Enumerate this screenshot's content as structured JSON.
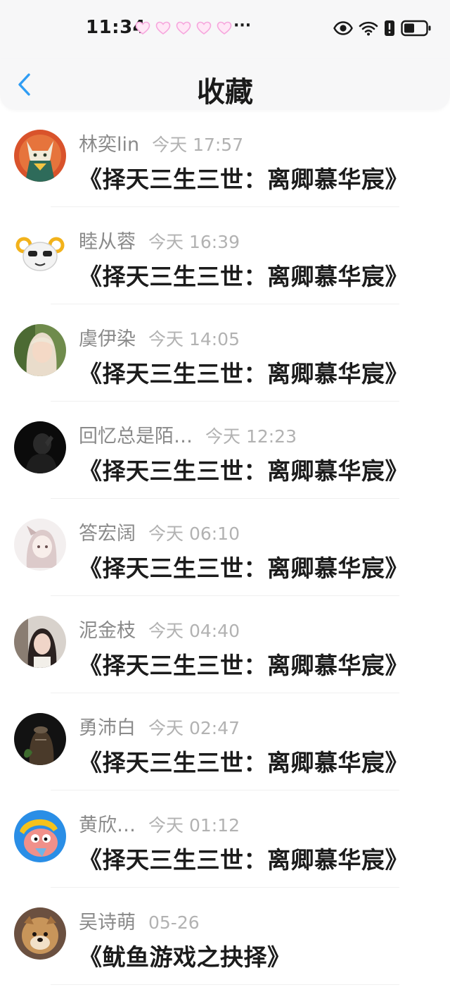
{
  "status_bar": {
    "time": "11:34",
    "more": "···",
    "icons": [
      "heart-icon",
      "eye-icon",
      "wifi-icon",
      "alert-icon",
      "battery-icon"
    ]
  },
  "header": {
    "title": "收藏",
    "back_icon": "chevron-left-icon"
  },
  "colors": {
    "accent": "#2f9df4",
    "heart": "#ff9ed8"
  },
  "favorites": [
    {
      "name": "林奕lin",
      "time": "今天 17:57",
      "message": "《择天三生三世：离卿慕华宸》"
    },
    {
      "name": "睦从蓉",
      "time": "今天 16:39",
      "message": "《择天三生三世：离卿慕华宸》"
    },
    {
      "name": "虞伊染",
      "time": "今天 14:05",
      "message": "《择天三生三世：离卿慕华宸》"
    },
    {
      "name": "回忆总是陌…",
      "time": "今天 12:23",
      "message": "《择天三生三世：离卿慕华宸》"
    },
    {
      "name": "答宏阔",
      "time": "今天 06:10",
      "message": "《择天三生三世：离卿慕华宸》"
    },
    {
      "name": "泥金枝",
      "time": "今天 04:40",
      "message": "《择天三生三世：离卿慕华宸》"
    },
    {
      "name": "勇沛白",
      "time": "今天 02:47",
      "message": "《择天三生三世：离卿慕华宸》"
    },
    {
      "name": "黄欣…",
      "time": "今天 01:12",
      "message": "《择天三生三世：离卿慕华宸》"
    },
    {
      "name": "吴诗萌",
      "time": "05-26",
      "message": "《鱿鱼游戏之抉择》"
    }
  ]
}
